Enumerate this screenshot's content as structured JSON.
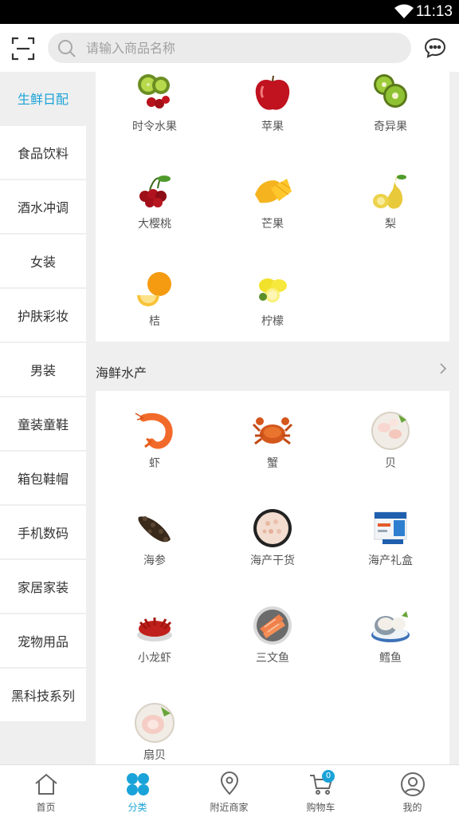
{
  "status_bar": {
    "time": "11:13"
  },
  "search": {
    "placeholder": "请输入商品名称"
  },
  "sidebar": {
    "items": [
      {
        "label": "生鲜日配",
        "active": true
      },
      {
        "label": "食品饮料"
      },
      {
        "label": "酒水冲调"
      },
      {
        "label": "女装"
      },
      {
        "label": "护肤彩妆"
      },
      {
        "label": "男装"
      },
      {
        "label": "童装童鞋"
      },
      {
        "label": "箱包鞋帽"
      },
      {
        "label": "手机数码"
      },
      {
        "label": "家居家装"
      },
      {
        "label": "宠物用品"
      },
      {
        "label": "黑科技系列"
      }
    ]
  },
  "fruit_section": {
    "items": [
      {
        "label": "时令水果",
        "icon": "seasonal-fruit-icon"
      },
      {
        "label": "苹果",
        "icon": "apple-icon"
      },
      {
        "label": "奇异果",
        "icon": "kiwi-icon"
      },
      {
        "label": "大樱桃",
        "icon": "cherry-icon"
      },
      {
        "label": "芒果",
        "icon": "mango-icon"
      },
      {
        "label": "梨",
        "icon": "pear-icon"
      },
      {
        "label": "桔",
        "icon": "orange-icon"
      },
      {
        "label": "柠檬",
        "icon": "lemon-icon"
      }
    ]
  },
  "seafood_section": {
    "title": "海鲜水产",
    "items": [
      {
        "label": "虾",
        "icon": "shrimp-icon"
      },
      {
        "label": "蟹",
        "icon": "crab-icon"
      },
      {
        "label": "贝",
        "icon": "shellfish-icon"
      },
      {
        "label": "海参",
        "icon": "sea-cucumber-icon"
      },
      {
        "label": "海产干货",
        "icon": "dried-seafood-icon"
      },
      {
        "label": "海产礼盒",
        "icon": "seafood-gift-box-icon"
      },
      {
        "label": "小龙虾",
        "icon": "crayfish-icon"
      },
      {
        "label": "三文鱼",
        "icon": "salmon-icon"
      },
      {
        "label": "鳕鱼",
        "icon": "cod-icon"
      },
      {
        "label": "扇贝",
        "icon": "scallop-icon"
      }
    ]
  },
  "tabbar": {
    "items": [
      {
        "label": "首页",
        "icon": "home-icon"
      },
      {
        "label": "分类",
        "icon": "category-icon",
        "active": true
      },
      {
        "label": "附近商家",
        "icon": "location-pin-icon"
      },
      {
        "label": "购物车",
        "icon": "cart-icon",
        "badge": "0"
      },
      {
        "label": "我的",
        "icon": "profile-icon"
      }
    ]
  },
  "colors": {
    "accent": "#1aa3d8",
    "background": "#efefef"
  }
}
